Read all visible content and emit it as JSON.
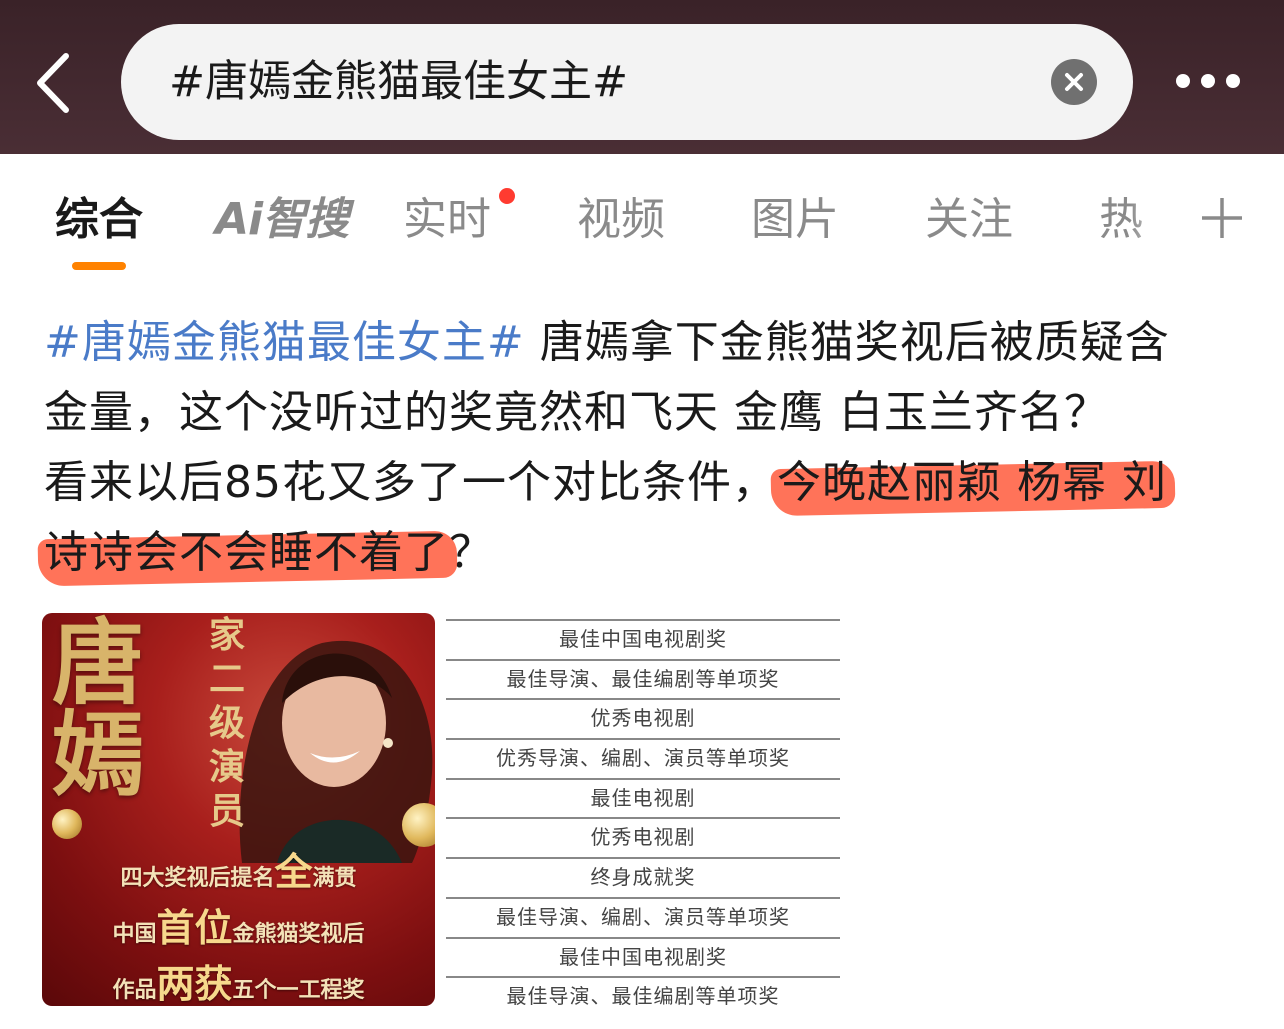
{
  "header": {
    "search_query": "#唐嫣金熊猫最佳女主#",
    "back_icon": "chevron-left-icon",
    "clear_icon": "close-icon",
    "more_icon": "more-dots-icon"
  },
  "tabs": {
    "items": [
      {
        "label": "综合",
        "active": true
      },
      {
        "label": "Ai智搜",
        "active": false
      },
      {
        "label": "实时",
        "active": false,
        "badge": "red-dot"
      },
      {
        "label": "视频",
        "active": false
      },
      {
        "label": "图片",
        "active": false
      },
      {
        "label": "关注",
        "active": false
      },
      {
        "label": "热",
        "active": false
      }
    ],
    "add_icon": "plus-icon",
    "indicator_color": "#ff8200"
  },
  "post": {
    "topic": "#唐嫣金熊猫最佳女主#",
    "line1_rest": " 唐嫣拿下金熊猫奖视后被质疑含",
    "line2": "金量，这个没听过的奖竟然和飞天 金鹰 白玉兰齐名？",
    "line3_a": "看来以后85花又多了一个对比条件，",
    "line3_hl": "今晚赵丽颖 杨幂 刘",
    "line4_hl": "诗诗会不会睡不着了",
    "line4_rest": "？",
    "link_color": "#4a7bc8",
    "highlight_color": "#ff5a3c"
  },
  "image_left": {
    "name_char_1": "唐",
    "name_char_2": "嫣",
    "vertical_text": [
      "家",
      "二",
      "级",
      "演",
      "员"
    ],
    "line1_small_a": "四大奖视后提名",
    "line1_big": "全",
    "line1_small_b": "满贯",
    "line2_small_a": "中国",
    "line2_big": "首位",
    "line2_small_b": "金熊猫奖视后",
    "line3_small_a": "作品",
    "line3_big": "两获",
    "line3_small_b": "五个一工程奖"
  },
  "image_right": {
    "rows": [
      "最佳中国电视剧奖",
      "最佳导演、最佳编剧等单项奖",
      "优秀电视剧",
      "优秀导演、编剧、演员等单项奖",
      "最佳电视剧",
      "优秀电视剧",
      "终身成就奖",
      "最佳导演、编剧、演员等单项奖",
      "最佳中国电视剧奖",
      "最佳导演、最佳编剧等单项奖"
    ]
  }
}
